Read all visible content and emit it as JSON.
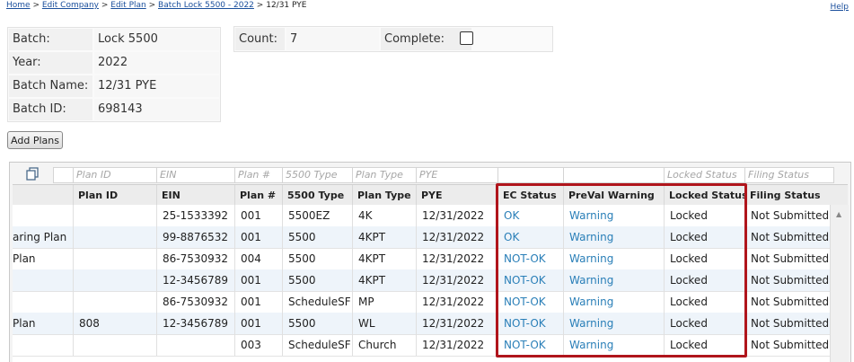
{
  "breadcrumb": {
    "items": [
      "Home",
      "Edit Company",
      "Edit Plan",
      "Batch Lock 5500 - 2022"
    ],
    "separator": ">",
    "current": "12/31 PYE"
  },
  "help_label": "Help",
  "batch_info": {
    "batch_label": "Batch:",
    "batch_value": "Lock 5500",
    "year_label": "Year:",
    "year_value": "2022",
    "name_label": "Batch Name:",
    "name_value": "12/31 PYE",
    "id_label": "Batch ID:",
    "id_value": "698143"
  },
  "summary": {
    "count_label": "Count:",
    "count_value": "7",
    "complete_label": "Complete:",
    "complete_checked": false
  },
  "add_plans_label": "Add Plans",
  "grid": {
    "filter_placeholders": [
      "Plan ID",
      "EIN",
      "Plan #",
      "5500 Type",
      "Plan Type",
      "PYE",
      "",
      "",
      "Locked Status",
      "Filing Status"
    ],
    "columns": [
      "",
      "Plan ID",
      "EIN",
      "Plan #",
      "5500 Type",
      "Plan Type",
      "PYE",
      "EC Status",
      "PreVal Warning",
      "Locked Status",
      "Filing Status"
    ],
    "rows": [
      {
        "name": "",
        "plan_id": "",
        "ein": "25-1533392",
        "plan_no": "001",
        "type5500": "5500EZ",
        "plan_type": "4K",
        "pye": "12/31/2022",
        "ec": "OK",
        "preval": "Warning",
        "locked": "Locked",
        "filing": "Not Submitted"
      },
      {
        "name": "aring Plan",
        "plan_id": "",
        "ein": "99-8876532",
        "plan_no": "001",
        "type5500": "5500",
        "plan_type": "4KPT",
        "pye": "12/31/2022",
        "ec": "OK",
        "preval": "Warning",
        "locked": "Locked",
        "filing": "Not Submitted"
      },
      {
        "name": "Plan",
        "plan_id": "",
        "ein": "86-7530932",
        "plan_no": "004",
        "type5500": "5500",
        "plan_type": "4KPT",
        "pye": "12/31/2022",
        "ec": "NOT-OK",
        "preval": "Warning",
        "locked": "Locked",
        "filing": "Not Submitted"
      },
      {
        "name": "",
        "plan_id": "",
        "ein": "12-3456789",
        "plan_no": "001",
        "type5500": "5500",
        "plan_type": "4KPT",
        "pye": "12/31/2022",
        "ec": "NOT-OK",
        "preval": "Warning",
        "locked": "Locked",
        "filing": "Not Submitted"
      },
      {
        "name": "",
        "plan_id": "",
        "ein": "86-7530932",
        "plan_no": "001",
        "type5500": "ScheduleSF",
        "plan_type": "MP",
        "pye": "12/31/2022",
        "ec": "NOT-OK",
        "preval": "Warning",
        "locked": "Locked",
        "filing": "Not Submitted"
      },
      {
        "name": "Plan",
        "plan_id": "808",
        "ein": "12-3456789",
        "plan_no": "001",
        "type5500": "5500",
        "plan_type": "WL",
        "pye": "12/31/2022",
        "ec": "NOT-OK",
        "preval": "Warning",
        "locked": "Locked",
        "filing": "Not Submitted"
      },
      {
        "name": "",
        "plan_id": "",
        "ein": "",
        "plan_no": "003",
        "type5500": "ScheduleSF",
        "plan_type": "Church",
        "pye": "12/31/2022",
        "ec": "NOT-OK",
        "preval": "Warning",
        "locked": "Locked",
        "filing": "Not Submitted"
      }
    ]
  },
  "colors": {
    "link": "#1a4f9c",
    "status_link": "#2a7fb8",
    "highlight_border": "#b0151c",
    "alt_row": "#eef4fa"
  }
}
